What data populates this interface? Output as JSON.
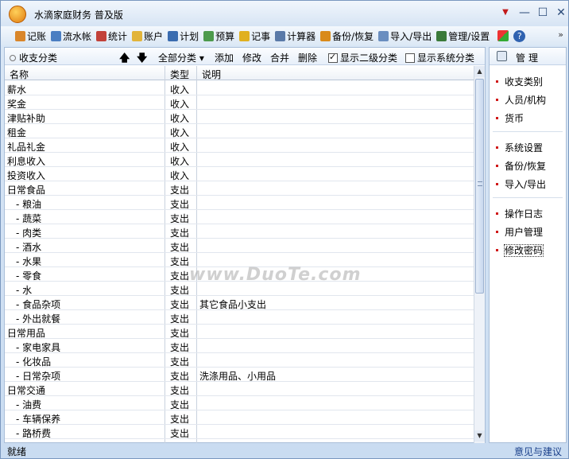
{
  "window": {
    "title": "水滴家庭财务  普及版",
    "controls": {
      "menu": "▼",
      "minimize": "—",
      "maximize": "☐",
      "close": "✕"
    }
  },
  "toolbar": {
    "items": [
      {
        "label": "记账",
        "icon": "pencil-icon",
        "color": "#d9862a"
      },
      {
        "label": "流水帐",
        "icon": "ledger-icon",
        "color": "#4a7ec2"
      },
      {
        "label": "统计",
        "icon": "bar-chart-icon",
        "color": "#c2423a"
      },
      {
        "label": "账户",
        "icon": "folder-icon",
        "color": "#e2b43a"
      },
      {
        "label": "计划",
        "icon": "info-icon",
        "color": "#3a6cb0"
      },
      {
        "label": "预算",
        "icon": "grid-icon",
        "color": "#4c9a4c"
      },
      {
        "label": "记事",
        "icon": "note-icon",
        "color": "#e0b020"
      },
      {
        "label": "计算器",
        "icon": "calculator-icon",
        "color": "#5a7aa8"
      },
      {
        "label": "备份/恢复",
        "icon": "backup-icon",
        "color": "#d98a1a"
      },
      {
        "label": "导入/导出",
        "icon": "import-export-icon",
        "color": "#6a8ec0"
      },
      {
        "label": "管理/设置",
        "icon": "settings-icon",
        "color": "#3a7a3a"
      }
    ],
    "extra_icons": [
      "store-icon",
      "help-icon"
    ],
    "help_glyph": "?",
    "more_glyph": "»"
  },
  "panel": {
    "title": "收支分类",
    "filter_label": "全部分类 ▾",
    "actions": {
      "add": "添加",
      "edit": "修改",
      "merge": "合并",
      "delete": "删除"
    },
    "show_level2": {
      "label": "显示二级分类",
      "checked": true
    },
    "show_system": {
      "label": "显示系统分类",
      "checked": false
    },
    "columns": {
      "name": "名称",
      "type": "类型",
      "note": "说明"
    },
    "rows": [
      {
        "name": "薪水",
        "type": "收入",
        "note": "",
        "child": false
      },
      {
        "name": "奖金",
        "type": "收入",
        "note": "",
        "child": false
      },
      {
        "name": "津贴补助",
        "type": "收入",
        "note": "",
        "child": false
      },
      {
        "name": "租金",
        "type": "收入",
        "note": "",
        "child": false
      },
      {
        "name": "礼品礼金",
        "type": "收入",
        "note": "",
        "child": false
      },
      {
        "name": "利息收入",
        "type": "收入",
        "note": "",
        "child": false
      },
      {
        "name": "投资收入",
        "type": "收入",
        "note": "",
        "child": false
      },
      {
        "name": "日常食品",
        "type": "支出",
        "note": "",
        "child": false
      },
      {
        "name": "- 粮油",
        "type": "支出",
        "note": "",
        "child": true
      },
      {
        "name": "- 蔬菜",
        "type": "支出",
        "note": "",
        "child": true
      },
      {
        "name": "- 肉类",
        "type": "支出",
        "note": "",
        "child": true
      },
      {
        "name": "- 酒水",
        "type": "支出",
        "note": "",
        "child": true
      },
      {
        "name": "- 水果",
        "type": "支出",
        "note": "",
        "child": true
      },
      {
        "name": "- 零食",
        "type": "支出",
        "note": "",
        "child": true
      },
      {
        "name": "- 水",
        "type": "支出",
        "note": "",
        "child": true
      },
      {
        "name": "- 食品杂项",
        "type": "支出",
        "note": "其它食品小支出",
        "child": true
      },
      {
        "name": "- 外出就餐",
        "type": "支出",
        "note": "",
        "child": true
      },
      {
        "name": "日常用品",
        "type": "支出",
        "note": "",
        "child": false
      },
      {
        "name": "- 家电家具",
        "type": "支出",
        "note": "",
        "child": true
      },
      {
        "name": "- 化妆品",
        "type": "支出",
        "note": "",
        "child": true
      },
      {
        "name": "- 日常杂项",
        "type": "支出",
        "note": "洗涤用品、小用品",
        "child": true
      },
      {
        "name": "日常交通",
        "type": "支出",
        "note": "",
        "child": false
      },
      {
        "name": "- 油费",
        "type": "支出",
        "note": "",
        "child": true
      },
      {
        "name": "- 车辆保养",
        "type": "支出",
        "note": "",
        "child": true
      },
      {
        "name": "- 路桥费",
        "type": "支出",
        "note": "",
        "child": true
      }
    ]
  },
  "sidebar": {
    "title": "管理",
    "groups": [
      [
        "收支类别",
        "人员/机构",
        "货币"
      ],
      [
        "系统设置",
        "备份/恢复",
        "导入/导出"
      ],
      [
        "操作日志",
        "用户管理",
        "修改密码"
      ]
    ]
  },
  "status": {
    "left": "就绪",
    "right": "意见与建议"
  },
  "watermark": "www.DuoTe.com"
}
